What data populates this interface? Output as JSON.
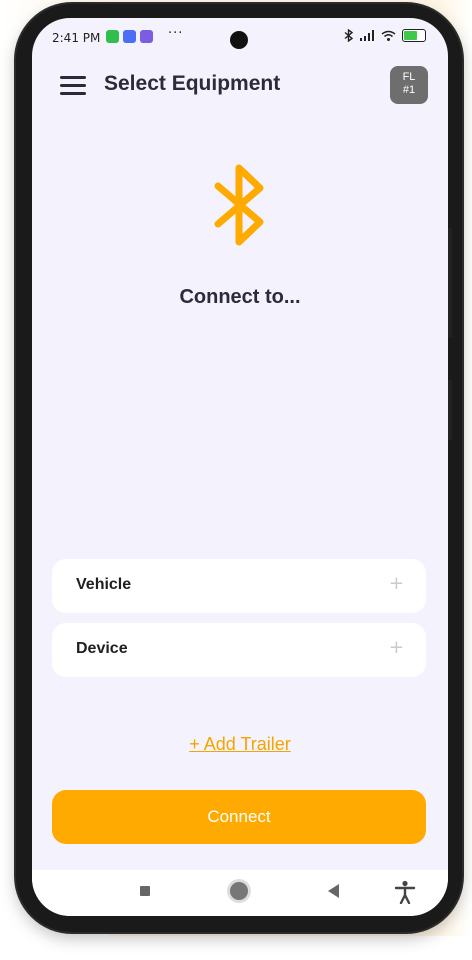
{
  "status": {
    "time": "2:41 PM",
    "more": "···"
  },
  "header": {
    "title": "Select Equipment",
    "badge_line1": "FL",
    "badge_line2": "#1"
  },
  "main": {
    "heading": "Connect to...",
    "fields": [
      {
        "label": "Vehicle",
        "action": "+"
      },
      {
        "label": "Device",
        "action": "+"
      }
    ],
    "add_trailer": "+ Add Trailer",
    "connect_label": "Connect"
  },
  "colors": {
    "accent": "#ffaa00",
    "screen_bg": "#f4f3fd"
  },
  "icons": [
    "menu-icon",
    "bluetooth-icon",
    "recents-icon",
    "home-icon",
    "back-icon",
    "accessibility-icon"
  ]
}
